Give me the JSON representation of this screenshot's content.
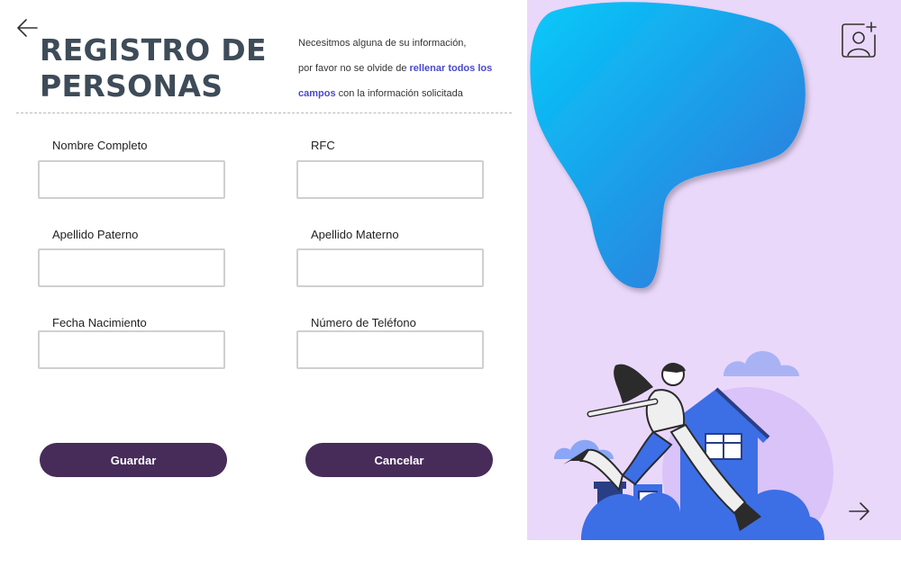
{
  "header": {
    "title_line1": "REGISTRO DE",
    "title_line2": "PERSONAS",
    "intro_part1": "Necesitmos alguna de su información,",
    "intro_part2": "por favor no se olvide de",
    "intro_highlight_1": "rellenar todos los",
    "intro_highlight_2": "campos",
    "intro_part3": "con la información solicitada"
  },
  "form": {
    "nombre_label": "Nombre Completo",
    "nombre_value": "",
    "rfc_label": "RFC",
    "rfc_value": "",
    "paterno_label": "Apellido Paterno",
    "paterno_value": "",
    "materno_label": "Apellido Materno",
    "materno_value": "",
    "nacimiento_label": "Fecha Nacimiento",
    "nacimiento_value": "",
    "telefono_label": "Número de Teléfono",
    "telefono_value": ""
  },
  "actions": {
    "save_label": "Guardar",
    "cancel_label": "Cancelar"
  },
  "icons": {
    "back": "arrow-left-icon",
    "next": "arrow-right-icon",
    "add_photo": "add-user-photo-icon"
  },
  "colors": {
    "button": "#472c5a",
    "title": "#3e4b58",
    "highlight": "#4a49c9",
    "panel": "#ead8fb",
    "blob_start": "#06c9f9",
    "blob_end": "#3470d8"
  }
}
